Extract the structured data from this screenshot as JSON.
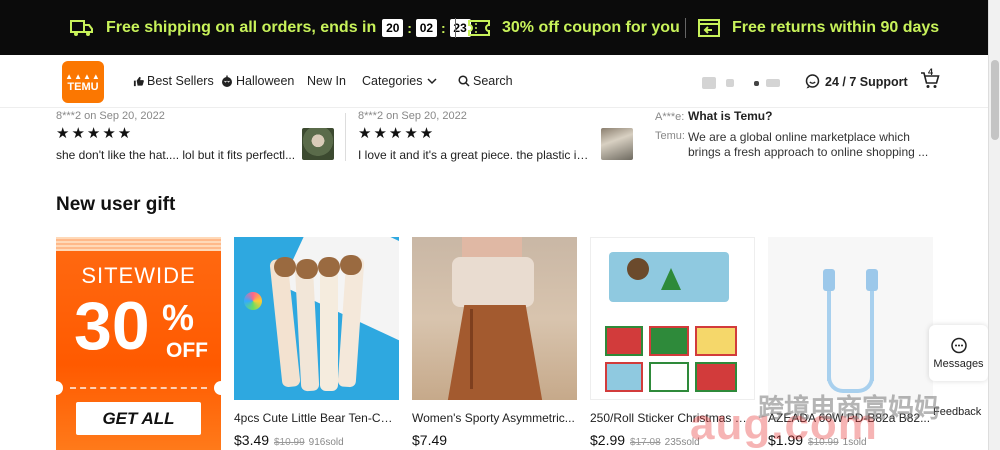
{
  "promo": {
    "shipping_text": "Free shipping on all orders, ends in",
    "timer": [
      "20",
      "02",
      "23"
    ],
    "coupon_text": "30% off coupon for you",
    "returns_text": "Free returns within 90 days",
    "accent_color": "#c8f25a"
  },
  "nav": {
    "logo_top": "▲▲▲▲",
    "logo_text": "TEMU",
    "best_sellers": "Best Sellers",
    "halloween": "Halloween",
    "new_in": "New In",
    "categories": "Categories",
    "search": "Search",
    "support": "24 / 7 Support",
    "cart_count": "4",
    "brand_color": "#fb7701"
  },
  "reviews": [
    {
      "meta": "8***2  on Sep 20, 2022",
      "stars": "★★★★★",
      "text": "she don't like the hat.... lol but it fits perfectl..."
    },
    {
      "meta": "8***2  on Sep 20, 2022",
      "stars": "★★★★★",
      "text": "I love it and it's a great piece. the plastic is n..."
    }
  ],
  "faq": {
    "q_user": "A***e:",
    "question": "What is Temu?",
    "a_user": "Temu:",
    "answer_line1": "We are a global online marketplace which",
    "answer_line2": "brings a fresh approach to online shopping ..."
  },
  "section": {
    "title": "New user gift"
  },
  "coupon": {
    "sitewide": "SITEWIDE",
    "percent_number": "30",
    "percent_sign": "%",
    "off": "OFF",
    "cta": "GET ALL"
  },
  "products": [
    {
      "title": "4pcs Cute Little Bear Ten-Col...",
      "price": "$3.49",
      "orig": "$10.99",
      "sold": "916sold"
    },
    {
      "title": "Women's Sporty Asymmetric...",
      "price": "$7.49",
      "orig": "",
      "sold": ""
    },
    {
      "title": "250/Roll Sticker Christmas Gif...",
      "price": "$2.99",
      "orig": "$17.08",
      "sold": "235sold"
    },
    {
      "title": "AZEADA 60W PD-B82a B82...",
      "price": "$1.99",
      "orig": "$10.99",
      "sold": "1sold"
    }
  ],
  "floating": {
    "messages": "Messages",
    "feedback": "Feedback"
  },
  "watermark": {
    "cn": "跨境电商富妈妈",
    "url": "aug.com"
  }
}
